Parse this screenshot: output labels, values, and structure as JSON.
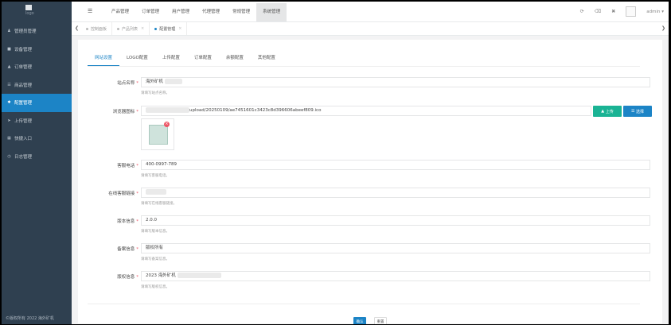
{
  "sidebar": {
    "logo_text": "logo",
    "items": [
      {
        "label": "管理员管理",
        "icon": "user-icon"
      },
      {
        "label": "设备管理",
        "icon": "device-icon"
      },
      {
        "label": "订单管理",
        "icon": "document-icon"
      },
      {
        "label": "商品管理",
        "icon": "list-icon"
      },
      {
        "label": "配置管理",
        "icon": "gear-icon",
        "active": true
      },
      {
        "label": "上传管理",
        "icon": "upload-icon"
      },
      {
        "label": "快捷入口",
        "icon": "grid-icon"
      },
      {
        "label": "日志管理",
        "icon": "clock-icon"
      }
    ],
    "footer": "©版权所有 2022 海外矿机"
  },
  "topbar": {
    "nav": [
      "产品管理",
      "订单管理",
      "用户管理",
      "代理管理",
      "常规管理",
      "系统管理"
    ],
    "active_nav": "系统管理",
    "admin": "admin ▾",
    "icons": [
      "refresh-icon",
      "trash-icon",
      "fullscreen-icon"
    ]
  },
  "tabs": [
    {
      "label": "控制面板",
      "active": false
    },
    {
      "label": "产品列表",
      "active": false
    },
    {
      "label": "配置管理",
      "active": true
    }
  ],
  "form_tabs": [
    "网站设置",
    "LOGO配置",
    "上传配置",
    "订单配置",
    "余额配置",
    "其他配置"
  ],
  "form": {
    "site_name": {
      "label": "站点名称",
      "value": "海外矿机",
      "help": "请填写站点名称。"
    },
    "favicon": {
      "label": "浏览器图标",
      "value": "upload/20250109/ae7451601c3423c8d396606abeef809.ico",
      "upload_label": "上传",
      "choose_label": "选择"
    },
    "phone": {
      "label": "客服电话",
      "value": "400-0997-789",
      "help": "请填写客服电话。"
    },
    "customer_link": {
      "label": "在线客服链接",
      "value": "",
      "help": "请填写在线客服链接。"
    },
    "version": {
      "label": "版本信息",
      "value": "2.0.0",
      "help": "请填写版本信息。"
    },
    "record": {
      "label": "备案信息",
      "value": "版权所有",
      "help": "请填写备案信息。"
    },
    "copyright": {
      "label": "版权信息",
      "value": "2023 海外矿机",
      "help": "请填写版权信息。"
    }
  },
  "actions": {
    "confirm": "确认",
    "reset": "重置"
  },
  "colors": {
    "sidebar": "#2f4050",
    "primary": "#1c84c6",
    "success": "#1ab394",
    "danger": "#ed5565"
  }
}
